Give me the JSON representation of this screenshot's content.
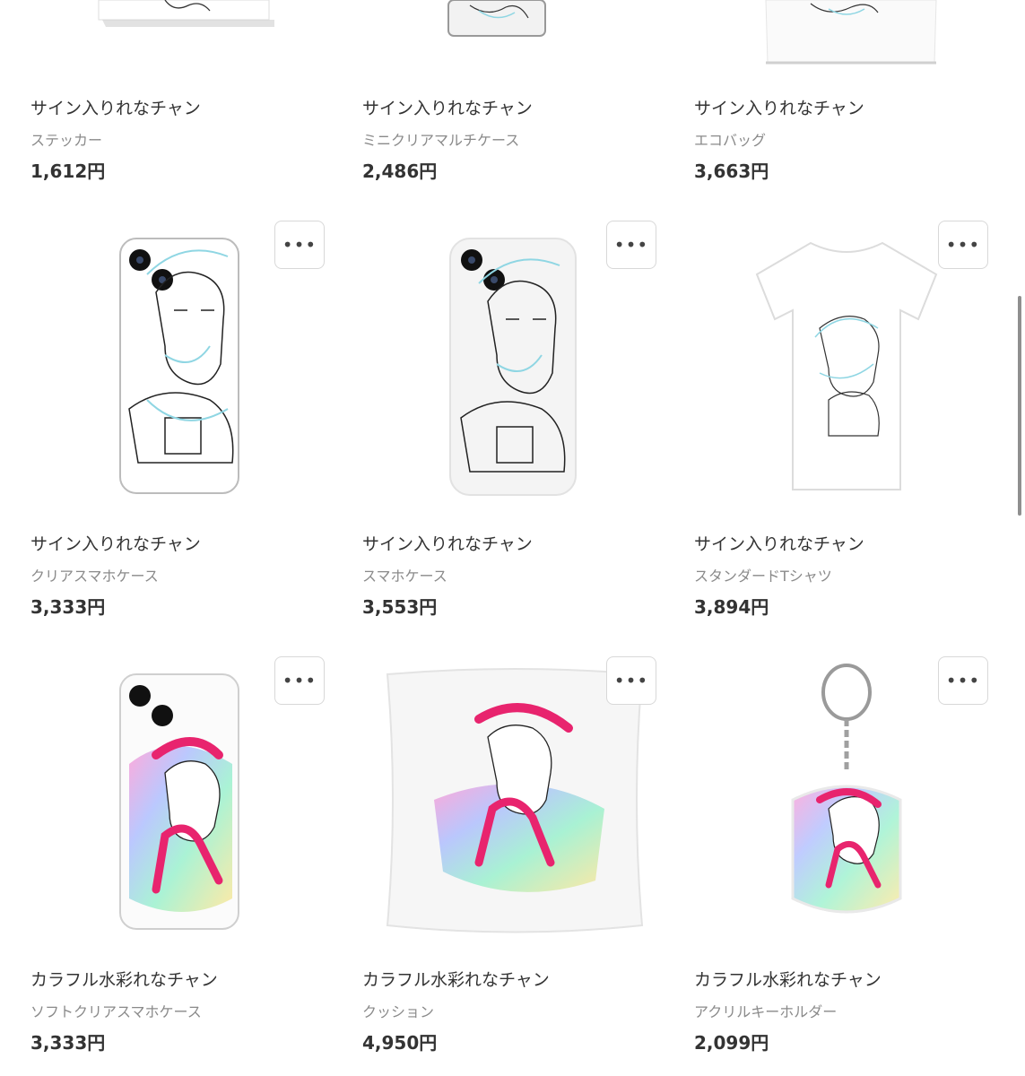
{
  "items": [
    {
      "title": "サイン入りれなチャン",
      "type": "ステッカー",
      "price": "1,612円",
      "image": "sticker-image"
    },
    {
      "title": "サイン入りれなチャン",
      "type": "ミニクリアマルチケース",
      "price": "2,486円",
      "image": "mini-case-image"
    },
    {
      "title": "サイン入りれなチャン",
      "type": "エコバッグ",
      "price": "3,663円",
      "image": "eco-bag-image"
    },
    {
      "title": "サイン入りれなチャン",
      "type": "クリアスマホケース",
      "price": "3,333円",
      "image": "clear-phone-case-image"
    },
    {
      "title": "サイン入りれなチャン",
      "type": "スマホケース",
      "price": "3,553円",
      "image": "phone-case-image"
    },
    {
      "title": "サイン入りれなチャン",
      "type": "スタンダードTシャツ",
      "price": "3,894円",
      "image": "tshirt-image"
    },
    {
      "title": "カラフル水彩れなチャン",
      "type": "ソフトクリアスマホケース",
      "price": "3,333円",
      "image": "soft-clear-phone-case-image"
    },
    {
      "title": "カラフル水彩れなチャン",
      "type": "クッション",
      "price": "4,950円",
      "image": "cushion-image"
    },
    {
      "title": "カラフル水彩れなチャン",
      "type": "アクリルキーホルダー",
      "price": "2,099円",
      "image": "acrylic-keyholder-image"
    }
  ],
  "more_button_label": "•••",
  "more_button_icon": "more-dots-icon",
  "colors": {
    "text": "#333333",
    "subtext": "#8a8a8a",
    "border": "#d8d8d8",
    "accent_pink": "#e8246e",
    "line_cyan": "#8fd6e3"
  }
}
